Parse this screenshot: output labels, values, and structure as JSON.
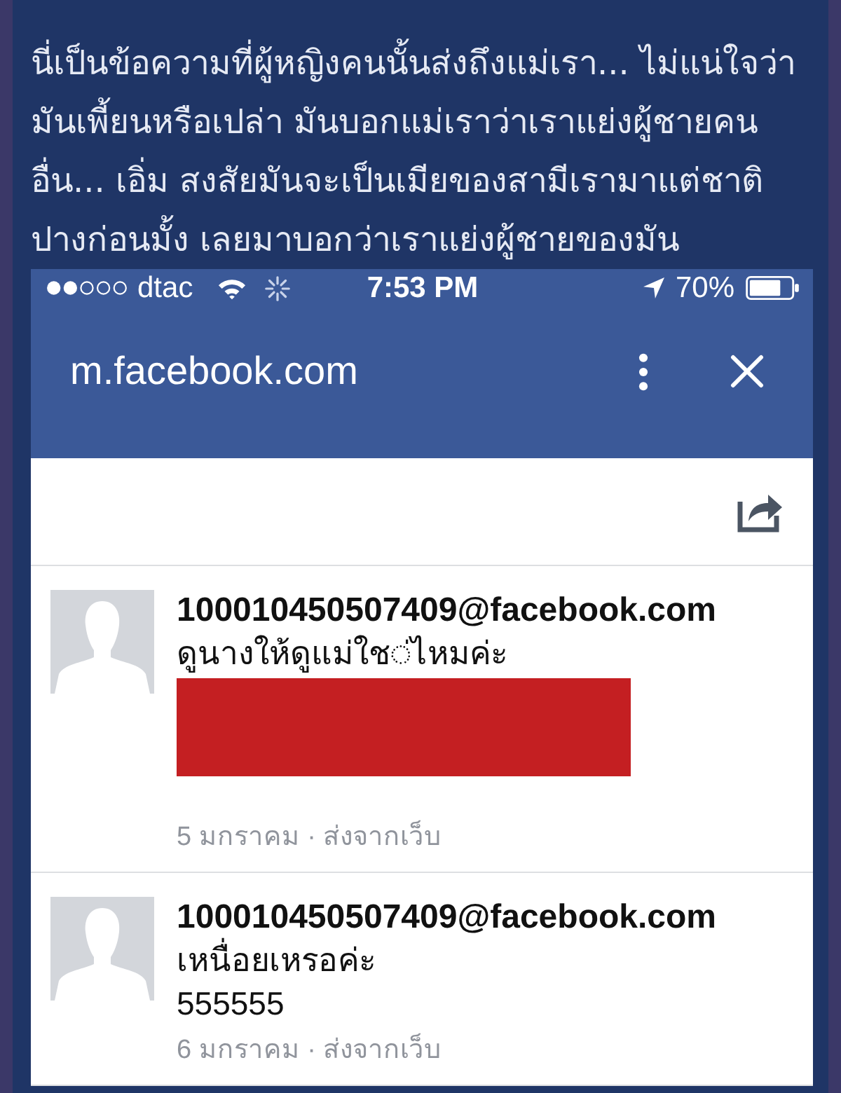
{
  "caption": "นี่เป็นข้อความที่ผู้หญิงคนนั้นส่งถึงแม่เรา... ไม่แน่ใจว่ามันเพี้ยนหรือเปล่า มันบอกแม่เราว่าเราแย่งผู้ชายคนอื่น... เอิ่ม สงสัยมันจะเป็นเมียของสามีเรามาแต่ชาติปางก่อนมั้ง เลยมาบอกว่าเราแย่งผู้ชายของมัน",
  "phone": {
    "status_bar": {
      "carrier": "dtac",
      "time": "7:53 PM",
      "battery": "70%"
    },
    "browser_bar": {
      "url": "m.facebook.com"
    },
    "messages": [
      {
        "sender": "100010450507409@facebook.com",
        "lines": [
          {
            "kind": "text",
            "text": "ดูนางให้ดูแม่ใช◌่ไหมค่ะ"
          },
          {
            "kind": "redacted"
          }
        ],
        "date": "5 มกราคม · ส่งจากเว็บ"
      },
      {
        "sender": "100010450507409@facebook.com",
        "lines": [
          {
            "kind": "text",
            "text": "เหนื่อยเหรอค่ะ"
          },
          {
            "kind": "text",
            "text": "555555"
          }
        ],
        "date": "6 มกราคม · ส่งจากเว็บ"
      }
    ]
  }
}
